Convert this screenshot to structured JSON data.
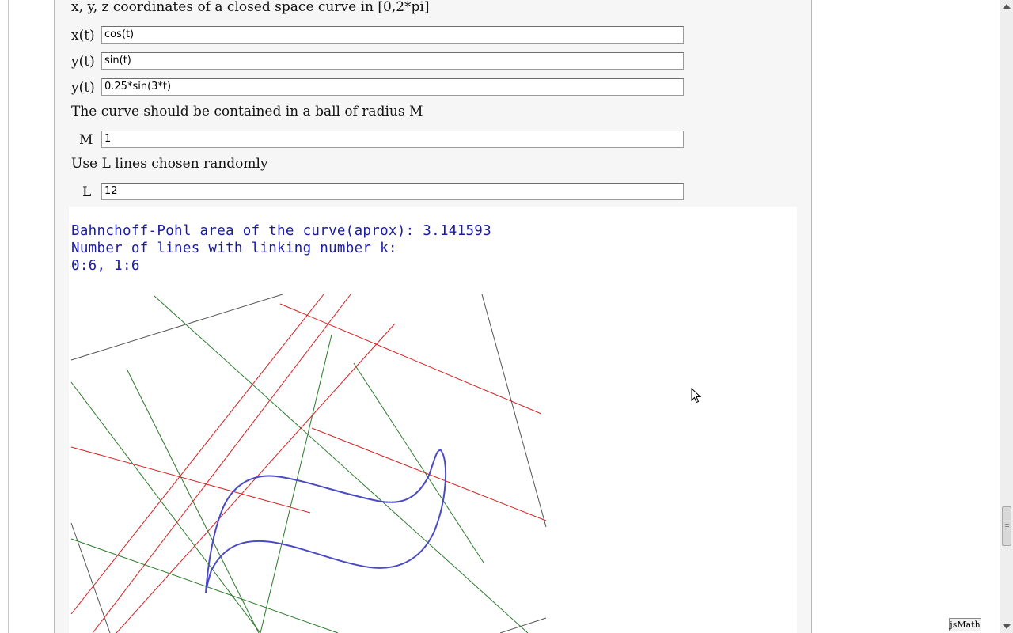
{
  "prompt": "x, y, z coordinates of a closed space curve in [0,2*pi]",
  "fields": [
    {
      "label": "x(t)",
      "value": "cos(t)"
    },
    {
      "label": "y(t)",
      "value": "sin(t)"
    },
    {
      "label": "y(t)",
      "value": "0.25*sin(3*t)"
    }
  ],
  "radius_prompt": "The curve should be contained in a ball of radius M",
  "radius_field": {
    "label": "M",
    "value": "1"
  },
  "lines_prompt": "Use L lines chosen randomly",
  "lines_field": {
    "label": "L",
    "value": "12"
  },
  "output": {
    "line1": "Bahnchoff-Pohl area of the curve(aprox): 3.141593",
    "line2": "Number of lines with linking number k:",
    "line3": "0:6, 1:6"
  },
  "jsmath_button": "jsMath",
  "colors": {
    "curve": "#4a4ac4",
    "link0_lines": "#2a7a2a",
    "link1_lines": "#d42020",
    "frame_lines": "#555555",
    "output_text": "#1a1aa8"
  },
  "icons": [
    "cursor-arrow-icon",
    "scroll-up-arrow-icon",
    "scroll-down-arrow-icon"
  ]
}
